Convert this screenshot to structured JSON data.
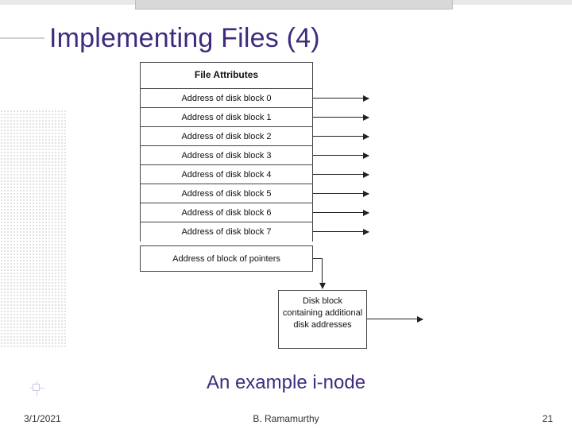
{
  "title": "Implementing Files (4)",
  "inode": {
    "header": "File Attributes",
    "blocks": [
      "Address of disk block 0",
      "Address of disk block 1",
      "Address of disk block 2",
      "Address of disk block 3",
      "Address of disk block 4",
      "Address of disk block 5",
      "Address of disk block 6",
      "Address of disk block 7"
    ],
    "pointer_block": "Address of block of pointers"
  },
  "extra_box": "Disk block containing additional disk addresses",
  "caption": "An example i-node",
  "footer": {
    "date": "3/1/2021",
    "author": "B. Ramamurthy",
    "page": "21"
  }
}
